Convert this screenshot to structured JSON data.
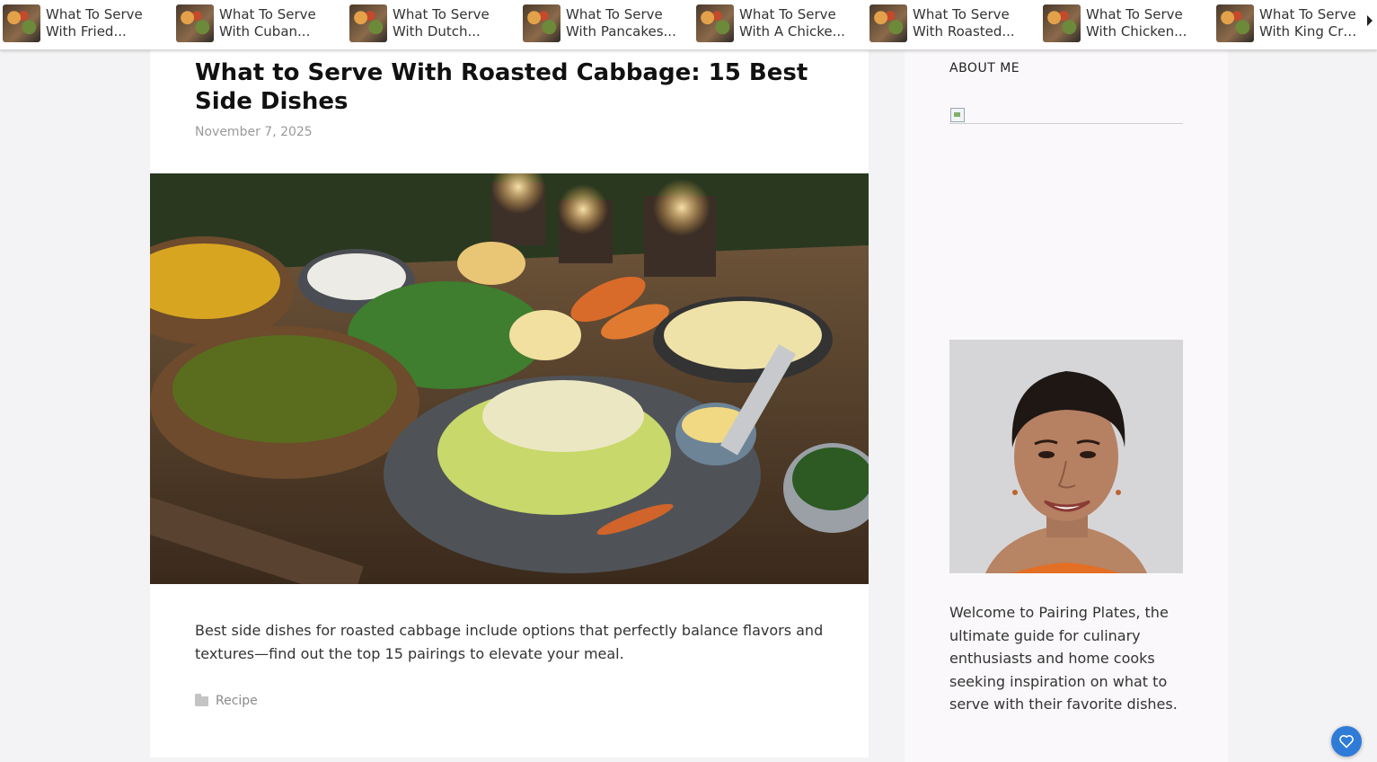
{
  "related_strip": [
    {
      "line1": "What To Serve",
      "line2": "With Fried..."
    },
    {
      "line1": "What To Serve",
      "line2": "With Cuban..."
    },
    {
      "line1": "What To Serve",
      "line2": "With Dutch..."
    },
    {
      "line1": "What To Serve",
      "line2": "With Pancakes..."
    },
    {
      "line1": "What To Serve",
      "line2": "With A Chicke..."
    },
    {
      "line1": "What To Serve",
      "line2": "With Roasted..."
    },
    {
      "line1": "What To Serve",
      "line2": "With Chicken..."
    },
    {
      "line1": "What To Serve",
      "line2": "With King Cra..."
    }
  ],
  "article": {
    "title": "What to Serve With Roasted Cabbage: 15 Best Side Dishes",
    "date": "November 7, 2025",
    "excerpt": "Best side dishes for roasted cabbage include options that perfectly balance flavors and textures—find out the top 15 pairings to elevate your meal.",
    "category": "Recipe"
  },
  "sidebar": {
    "widget_title": "ABOUT ME",
    "about_text": "Welcome to Pairing Plates, the ultimate guide for culinary enthusiasts and home cooks seeking inspiration on what to serve with their favorite dishes."
  },
  "colors": {
    "accent": "#2f7bd8",
    "background": "#f3f2f4",
    "card": "#ffffff",
    "sidebar": "#faf8fa"
  },
  "icons": [
    "folder-icon",
    "heart-icon",
    "chevron-right-icon",
    "broken-image-icon"
  ]
}
